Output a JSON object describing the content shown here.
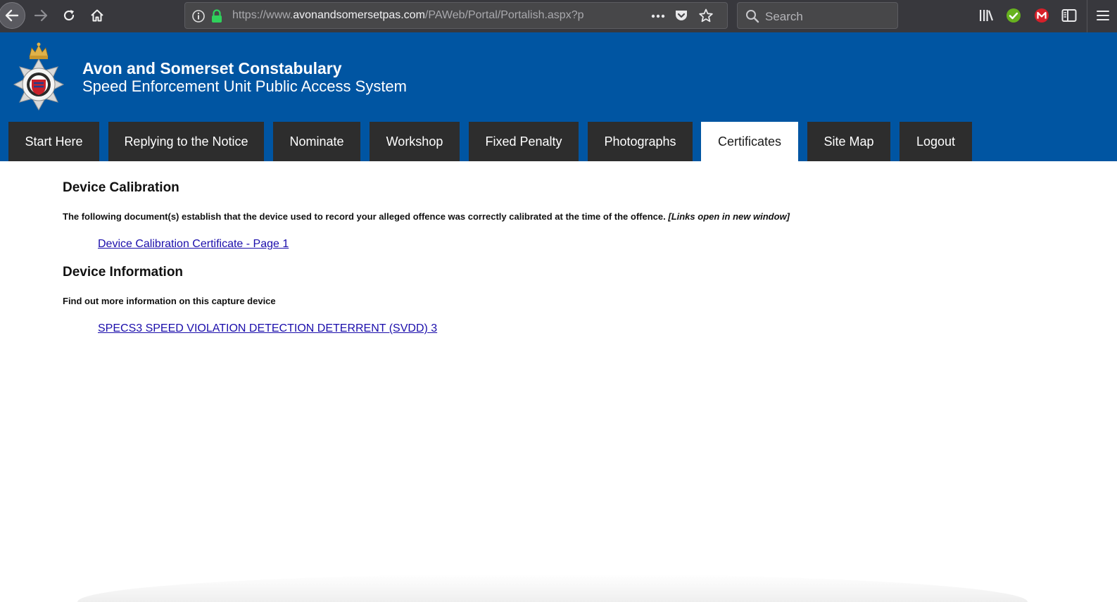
{
  "browser": {
    "url_prefix": "https://www.",
    "url_domain": "avonandsomersetpas.com",
    "url_path": "/PAWeb/Portal/Portalish.aspx?p",
    "search_placeholder": "Search",
    "icons": [
      "back-arrow-icon",
      "forward-arrow-icon",
      "reload-icon",
      "home-icon",
      "info-icon",
      "lock-icon",
      "more-icon",
      "pocket-icon",
      "bookmark-star-icon",
      "search-icon",
      "library-icon",
      "check-extension-icon",
      "m-extension-icon",
      "sidebar-icon",
      "menu-icon"
    ]
  },
  "header": {
    "org_name": "Avon and Somerset Constabulary",
    "system_name": "Speed Enforcement Unit Public Access System",
    "colors": {
      "band": "#0055a2",
      "tab": "#2d2d2d",
      "active_tab": "#ffffff",
      "link": "#1a0dab"
    }
  },
  "tabs": [
    {
      "label": "Start Here",
      "active": false
    },
    {
      "label": "Replying to the Notice",
      "active": false
    },
    {
      "label": "Nominate",
      "active": false
    },
    {
      "label": "Workshop",
      "active": false
    },
    {
      "label": "Fixed Penalty",
      "active": false
    },
    {
      "label": "Photographs",
      "active": false
    },
    {
      "label": "Certificates",
      "active": true
    },
    {
      "label": "Site Map",
      "active": false
    },
    {
      "label": "Logout",
      "active": false
    }
  ],
  "calibration": {
    "heading": "Device Calibration",
    "description": "The following document(s) establish that the device used to record your alleged offence was correctly calibrated at the time of the offence.",
    "note": "[Links open in new window]",
    "link": "Device Calibration Certificate - Page 1"
  },
  "information": {
    "heading": "Device Information",
    "description": "Find out more information on this capture device",
    "link": "SPECS3 SPEED VIOLATION DETECTION DETERRENT (SVDD) 3"
  }
}
